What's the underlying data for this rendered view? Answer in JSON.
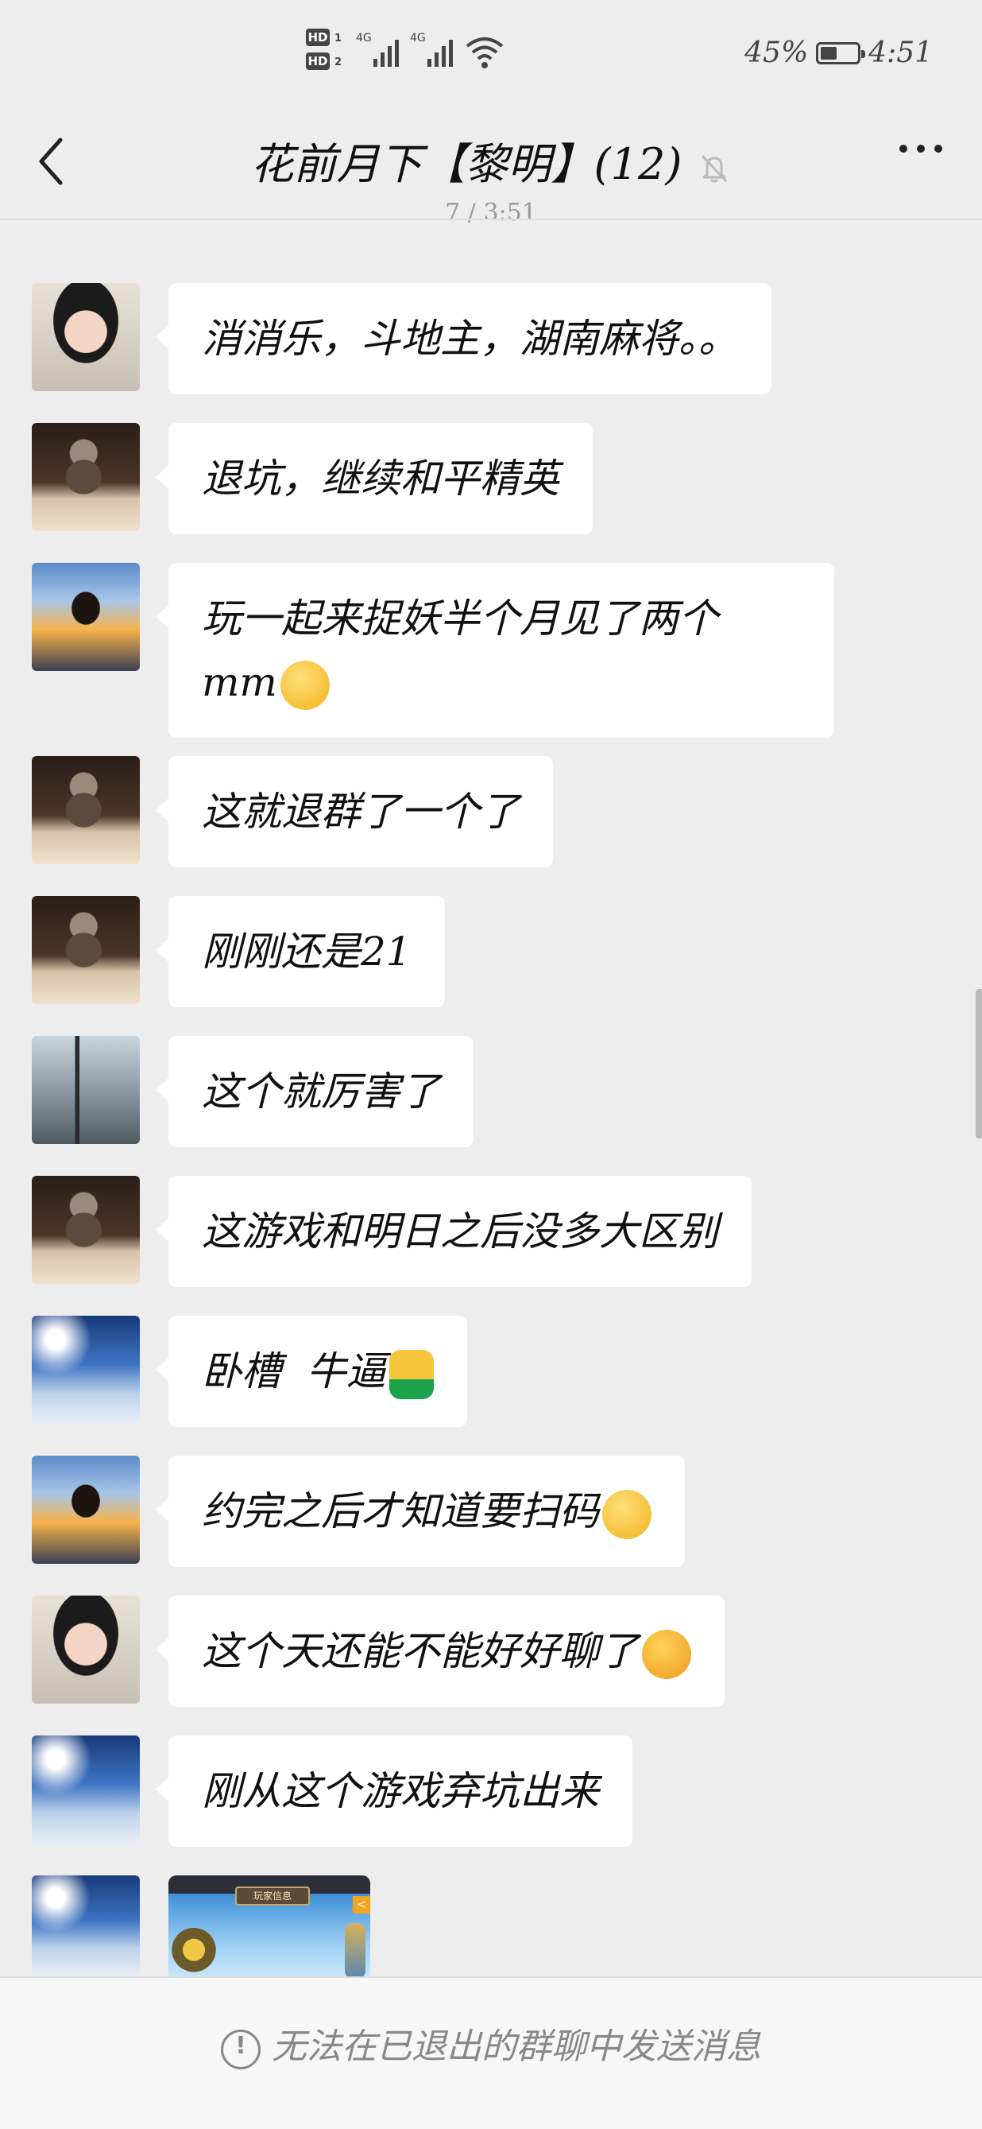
{
  "status_bar": {
    "battery_text": "45%",
    "battery_level": 0.45,
    "time": "4:51",
    "hd1": "HD",
    "hd1_sub": "1",
    "hd2": "HD",
    "hd2_sub": "2",
    "net1": "4G",
    "net2": "4G"
  },
  "header": {
    "title": "花前月下【黎明】(12)",
    "timestamp_partial": "7 / 3:51"
  },
  "messages": [
    {
      "avatar": "woman",
      "text": "消消乐，斗地主，湖南麻将。。"
    },
    {
      "avatar": "child",
      "text": "退坑，继续和平精英"
    },
    {
      "avatar": "eagle",
      "text": "玩一起来捉妖半个月见了两个\nmm",
      "emoji": "grin-emoji"
    },
    {
      "avatar": "child",
      "text": "这就退群了一个了"
    },
    {
      "avatar": "child",
      "text": "刚刚还是21"
    },
    {
      "avatar": "balcony",
      "text": "这个就厉害了"
    },
    {
      "avatar": "child",
      "text": "这游戏和明日之后没多大区别"
    },
    {
      "avatar": "sky",
      "text": "卧槽  牛逼",
      "emoji": "thumbs-up-emoji"
    },
    {
      "avatar": "eagle",
      "text": "约完之后才知道要扫码",
      "emoji": "dizzy-emoji"
    },
    {
      "avatar": "woman",
      "text": "这个天还能不能好好聊了",
      "emoji": "angry-emoji"
    },
    {
      "avatar": "sky",
      "text": "刚从这个游戏弃坑出来"
    },
    {
      "avatar": "sky",
      "image_banner": "玩家信息",
      "image_corner": "<"
    }
  ],
  "footer": {
    "notice": "无法在已退出的群聊中发送消息",
    "notice_icon": "!"
  }
}
